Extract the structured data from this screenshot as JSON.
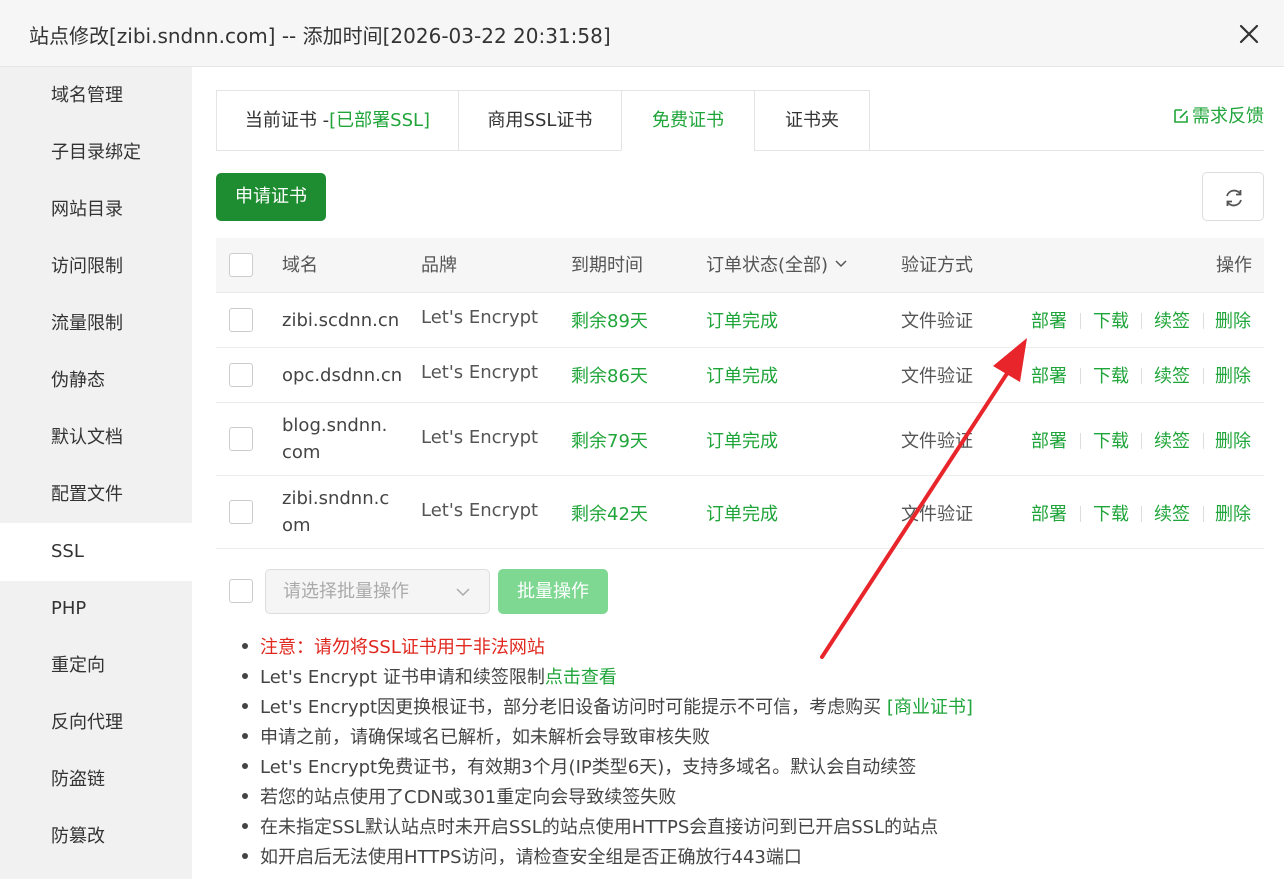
{
  "window": {
    "title": "站点修改[zibi.sndnn.com] -- 添加时间[2026-03-22 20:31:58]"
  },
  "sidebar": {
    "items": [
      {
        "label": "域名管理"
      },
      {
        "label": "子目录绑定"
      },
      {
        "label": "网站目录"
      },
      {
        "label": "访问限制"
      },
      {
        "label": "流量限制"
      },
      {
        "label": "伪静态"
      },
      {
        "label": "默认文档"
      },
      {
        "label": "配置文件"
      },
      {
        "label": "SSL"
      },
      {
        "label": "PHP"
      },
      {
        "label": "重定向"
      },
      {
        "label": "反向代理"
      },
      {
        "label": "防盗链"
      },
      {
        "label": "防篡改"
      }
    ],
    "active": "SSL"
  },
  "tabs": {
    "current_prefix": "当前证书 -",
    "current_status": "[已部署SSL]",
    "commercial": "商用SSL证书",
    "free": "免费证书",
    "folder": "证书夹",
    "active": "免费证书"
  },
  "feedback": "需求反馈",
  "toolbar": {
    "apply_label": "申请证书"
  },
  "table": {
    "headers": {
      "domain": "域名",
      "brand": "品牌",
      "expire": "到期时间",
      "status": "订单状态(全部)",
      "verify": "验证方式",
      "actions": "操作"
    },
    "rows": [
      {
        "domain": "zibi.scdnn.cn",
        "brand": "Let's Encrypt",
        "expire": "剩余89天",
        "status": "订单完成",
        "verify": "文件验证"
      },
      {
        "domain": "opc.dsdnn.cn",
        "brand": "Let's Encrypt",
        "expire": "剩余86天",
        "status": "订单完成",
        "verify": "文件验证"
      },
      {
        "domain": "blog.sndnn.com",
        "brand": "Let's Encrypt",
        "expire": "剩余79天",
        "status": "订单完成",
        "verify": "文件验证"
      },
      {
        "domain": "zibi.sndnn.com",
        "brand": "Let's Encrypt",
        "expire": "剩余42天",
        "status": "订单完成",
        "verify": "文件验证"
      }
    ],
    "actions": {
      "deploy": "部署",
      "download": "下载",
      "renew": "续签",
      "delete": "删除"
    }
  },
  "batch": {
    "placeholder": "请选择批量操作",
    "button": "批量操作"
  },
  "notes": {
    "warning": "注意：请勿将SSL证书用于非法网站",
    "limit_prefix": "Let's Encrypt 证书申请和续签限制",
    "limit_link": "点击查看",
    "root_prefix": "Let's Encrypt因更换根证书，部分老旧设备访问时可能提示不可信，考虑购买 ",
    "root_link": "[商业证书]",
    "resolve": "申请之前，请确保域名已解析，如未解析会导致审核失败",
    "validity": "Let's Encrypt免费证书，有效期3个月(IP类型6天)，支持多域名。默认会自动续签",
    "cdn": "若您的站点使用了CDN或301重定向会导致续签失败",
    "https_default": "在未指定SSL默认站点时未开启SSL的站点使用HTTPS会直接访问到已开启SSL的站点",
    "port": "如开启后无法使用HTTPS访问，请检查安全组是否正确放行443端口"
  },
  "colors": {
    "accent": "#20a53a",
    "primary_button": "#1e8d32",
    "warning": "#e0281f",
    "annotation_arrow": "#e8252a"
  }
}
